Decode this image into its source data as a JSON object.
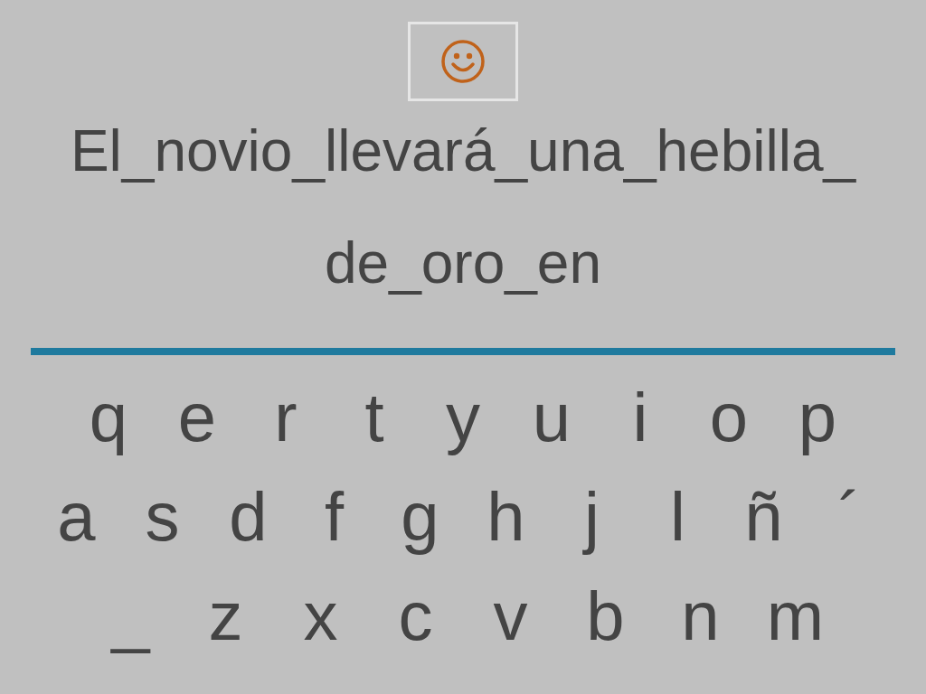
{
  "sentence_lines": [
    "El_novio_llevará_una_hebilla_",
    "de_oro_en"
  ],
  "keyboard": {
    "rows": [
      [
        "q",
        "e",
        "r",
        "t",
        "y",
        "u",
        "i",
        "o",
        "p"
      ],
      [
        "a",
        "s",
        "d",
        "f",
        "g",
        "h",
        "j",
        "l",
        "ñ",
        "´"
      ],
      [
        "_",
        "z",
        "x",
        "c",
        "v",
        "b",
        "n",
        "m"
      ]
    ]
  }
}
